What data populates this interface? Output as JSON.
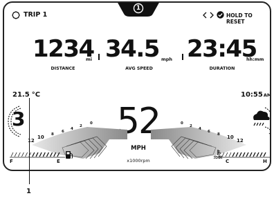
{
  "header": {
    "trip_number": "1",
    "trip_label": "TRIP 1",
    "hold_to_reset": "HOLD TO RESET"
  },
  "trip_stats": {
    "distance_value": "1234",
    "distance_unit": "mi",
    "distance_label": "DISTANCE",
    "speed_value": "34.5",
    "speed_unit": "mph",
    "speed_label": "AVG SPEED",
    "duration_value": "23:45",
    "duration_unit": "hh:mm",
    "duration_label": "DURATION"
  },
  "status": {
    "temperature": "21.5",
    "temperature_unit": "°C",
    "clock": "10:55",
    "clock_ampm": "AM",
    "gear_left": "3"
  },
  "speed": {
    "value": "52",
    "unit": "MPH",
    "rpm_caption": "x1000rpm"
  },
  "tach_left": [
    "0",
    "2",
    "4",
    "6",
    "8",
    "10",
    "12"
  ],
  "tach_right": [
    "0",
    "2",
    "4",
    "6",
    "8",
    "10",
    "12"
  ],
  "fuel_gauge": {
    "full": "F",
    "empty": "E",
    "level": 0.6
  },
  "temp_gauge": {
    "cold": "C",
    "hot": "H",
    "level": 0.7
  },
  "callout": "1",
  "icons": {
    "tab_left": "circle-dotted-icon",
    "tab_right": "chevron-arrows-icon",
    "weather": "cloud-rain-icon",
    "fuel": "fuel-pump-icon",
    "coolant": "coolant-temp-icon",
    "reset": "check-circle-icon"
  }
}
